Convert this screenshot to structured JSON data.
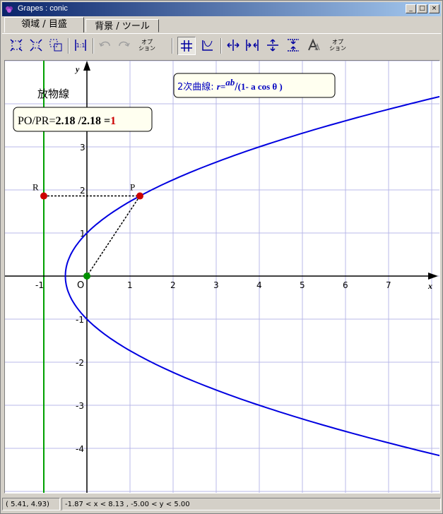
{
  "window": {
    "title": "Grapes : conic",
    "buttons": [
      "_",
      "□",
      "×"
    ]
  },
  "tabs": [
    {
      "label": "領域 / 目盛",
      "active": true
    },
    {
      "label": "背景 / ツール",
      "active": false
    }
  ],
  "toolbar": {
    "option_label_1": "オプ\nション",
    "option_label_2": "オプ\nション",
    "option_label_3": "オプ\nション"
  },
  "graph": {
    "axis_x_label": "x",
    "axis_y_label": "y",
    "origin_label": "O",
    "x_ticks": [
      "-1",
      "1",
      "2",
      "3",
      "4",
      "5",
      "6",
      "7"
    ],
    "y_ticks": [
      "3",
      "2",
      "1",
      "-1",
      "-2",
      "-3",
      "-4"
    ],
    "curve_name": "放物線",
    "point_R": "R",
    "point_P": "P",
    "ratio_prefix": "PO/PR=",
    "ratio_num": "2.18",
    "ratio_den": "/2.18",
    "ratio_eq": "=",
    "ratio_val": "1",
    "formula_prefix": "2次曲線: ",
    "formula_r": "r=",
    "formula_ab": "ab",
    "formula_slash": "/",
    "formula_rest": "(1- a cos θ )",
    "colors": {
      "curve": "#0000e0",
      "directrix": "#00a000",
      "grid": "#b8b8e8",
      "point": "#cc0000"
    }
  },
  "status": {
    "cursor": "( 5.41, 4.93)",
    "range": "-1.87 < x <  8.13 , -5.00 < y <  5.00"
  }
}
